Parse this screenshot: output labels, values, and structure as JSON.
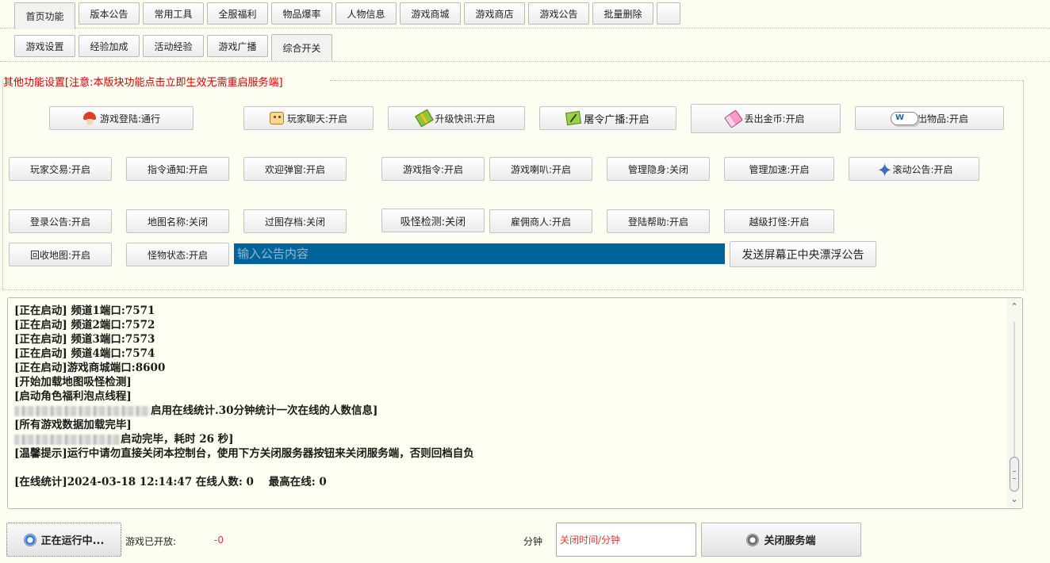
{
  "tabs_row1": [
    {
      "label": "首页功能",
      "active": true
    },
    {
      "label": "版本公告"
    },
    {
      "label": "常用工具"
    },
    {
      "label": "全服福利"
    },
    {
      "label": "物品爆率"
    },
    {
      "label": "人物信息"
    },
    {
      "label": "游戏商城"
    },
    {
      "label": "游戏商店"
    },
    {
      "label": "游戏公告"
    },
    {
      "label": "批量删除"
    },
    {
      "label": ""
    }
  ],
  "tabs_row2": [
    {
      "label": "游戏设置"
    },
    {
      "label": "经验加成"
    },
    {
      "label": "活动经验"
    },
    {
      "label": "游戏广播"
    },
    {
      "label": "综合开关",
      "active": true
    }
  ],
  "group": {
    "title": "其他功能设置[注意:本版块功能点击立即生效无需重启服务端]"
  },
  "switches": {
    "game_login": "游戏登陆:通行",
    "player_chat": "玩家聊天:开启",
    "levelup_news": "升级快讯:开启",
    "kill_broadcast": "屠令广播:开启",
    "drop_gold": "丢出金币:开启",
    "drop_item": "丢出物品:开启",
    "player_trade": "玩家交易:开启",
    "cmd_notice": "指令通知:开启",
    "welcome_popup": "欢迎弹窗:开启",
    "game_cmd": "游戏指令:开启",
    "game_horn": "游戏喇叭:开启",
    "admin_hide": "管理隐身:关闭",
    "admin_speed": "管理加速:开启",
    "scroll_notice": "滚动公告:开启",
    "login_notice": "登录公告:开启",
    "map_name": "地图名称:关闭",
    "map_save": "过图存档:关闭",
    "monster_pull": "吸怪检测:关闭",
    "hire_merchant": "雇佣商人:开启",
    "login_help": "登陆帮助:开启",
    "overlevel_hit": "越级打怪:开启",
    "recycle_map": "回收地图:开启",
    "monster_state": "怪物状态:开启"
  },
  "notice": {
    "placeholder": "输入公告内容",
    "send_label": "发送屏幕正中央漂浮公告"
  },
  "log": [
    {
      "text": "[正在启动] 频道1端口:7571"
    },
    {
      "text": "[正在启动] 频道2端口:7572"
    },
    {
      "text": "[正在启动] 频道3端口:7573"
    },
    {
      "text": "[正在启动] 频道4端口:7574"
    },
    {
      "text": "[正在启动]游戏商城端口:8600"
    },
    {
      "text": "[开始加载地图吸怪检测]"
    },
    {
      "text": "[启动角色福利泡点线程]"
    },
    {
      "redacted": "long",
      "text": "启用在线统计.30分钟统计一次在线的人数信息]"
    },
    {
      "text": "[所有游戏数据加载完毕]"
    },
    {
      "redacted": "short",
      "text": "启动完毕，耗时 26 秒]"
    },
    {
      "text": "[温馨提示]运行中请勿直接关闭本控制台，使用下方关闭服务器按钮来关闭服务端，否则回档自负"
    },
    {
      "text": ""
    },
    {
      "text": "[在线统计]2024-03-18 12:14:47 在线人数: 0    最高在线: 0"
    }
  ],
  "bottom": {
    "running_label": "正在运行中...",
    "open_label": "游戏已开放:",
    "open_value": "-0",
    "minutes_label": "分钟",
    "time_placeholder": "关闭时间/分钟",
    "stop_label": "关闭服务端"
  },
  "icons": {
    "game_login": "mushroom-icon",
    "player_chat": "chat-face-icon",
    "levelup_news": "gift-icon",
    "kill_broadcast": "note-icon",
    "drop_gold": "eraser-icon",
    "drop_item": "cloud-w-icon",
    "scroll_notice": "star-icon",
    "power": "power-icon"
  },
  "colors": {
    "background": "#fdfdf1",
    "title_red": "#d40000",
    "input_blue": "#00649b",
    "value_red": "#e23a3a"
  }
}
